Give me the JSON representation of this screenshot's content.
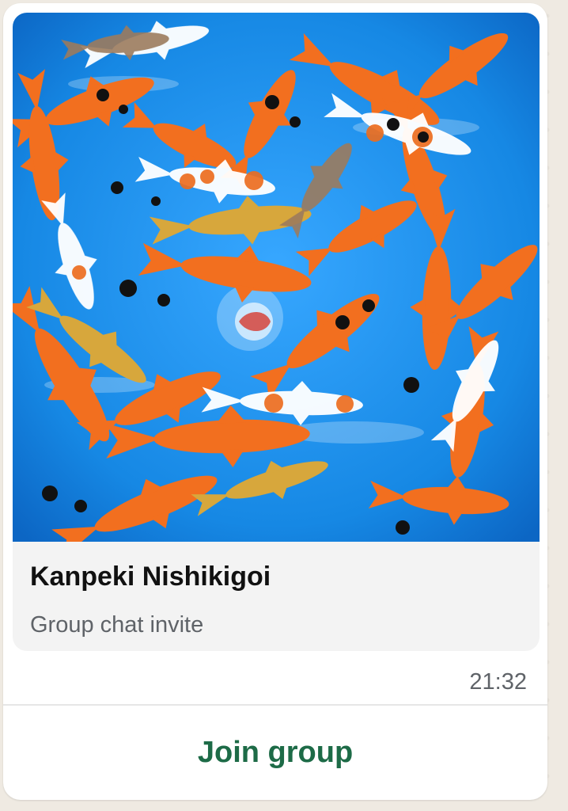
{
  "invite_card": {
    "group_name": "Kanpeki Nishikigoi",
    "subtitle": "Group chat invite",
    "image_description_icon": "koi-fish-photo"
  },
  "message": {
    "timestamp": "21:32"
  },
  "actions": {
    "join_label": "Join group"
  },
  "colors": {
    "accent": "#1d6b47",
    "water": "#1f8fe8",
    "bubble": "#ffffff",
    "card": "#f3f3f3"
  }
}
